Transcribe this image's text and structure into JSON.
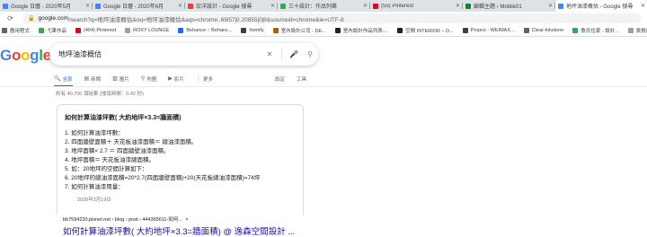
{
  "tabs": [
    {
      "title": "Google 日曆 - 2020年5月",
      "color": "#4285f4",
      "active": false
    },
    {
      "title": "Google 日曆 - 2020年6月",
      "color": "#4285f4",
      "active": false
    },
    {
      "title": "宏洋設計 - Google 搜尋",
      "color": "#ea4335",
      "active": false
    },
    {
      "title": "三十設計：作品列舉",
      "color": "#34a853",
      "active": false
    },
    {
      "title": "(55) Pinterest",
      "color": "#e60023",
      "active": false
    },
    {
      "title": "編輯主題 › Mobile01",
      "color": "#188038",
      "active": false
    },
    {
      "title": "地坪油漆概估 - Google 搜尋",
      "color": "#4285f4",
      "active": true
    }
  ],
  "address_bar": {
    "host": "google.com",
    "path": "/search?q=地坪油漆概估&oq=地坪油漆概估&aqs=chrome..69i57j0.20855j0j8&sourceid=chrome&ie=UTF-8"
  },
  "bookmarks": [
    {
      "label": "應用程式",
      "color": "#5f6368"
    },
    {
      "label": "弋果作品",
      "color": "#34a853"
    },
    {
      "label": "(404) Pinterest",
      "color": "#e60023"
    },
    {
      "label": "ROXY LOUNGE",
      "color": "#9aa0a6"
    },
    {
      "label": "Behance :: Behanc...",
      "color": "#1769ff"
    },
    {
      "label": "homify",
      "color": "#3c4043"
    },
    {
      "label": "室內設計公司 - DE...",
      "color": "#b06000"
    },
    {
      "label": "室內設計作品列表-...",
      "color": "#202124"
    },
    {
      "label": "空間 INTERIOR – D...",
      "color": "#202124"
    },
    {
      "label": "Project - WEIMAX...",
      "color": "#3c4043"
    },
    {
      "label": "Clear-Inkstone",
      "color": "#5f6368"
    },
    {
      "label": "詹氏住家 - 設計...",
      "color": "#34a853"
    },
    {
      "label": "挑殼設計 - G",
      "color": "#9aa0a6"
    }
  ],
  "logo": {
    "letters": [
      {
        "ch": "G",
        "color": "#4285f4"
      },
      {
        "ch": "o",
        "color": "#ea4335"
      },
      {
        "ch": "o",
        "color": "#fbbc05"
      },
      {
        "ch": "g",
        "color": "#4285f4"
      },
      {
        "ch": "l",
        "color": "#34a853"
      },
      {
        "ch": "e",
        "color": "#ea4335"
      }
    ]
  },
  "search": {
    "query": "地坪油漆概估"
  },
  "result_tabs": [
    {
      "label": "全部",
      "icon": "search-icon",
      "glyph": "🔍",
      "active": true
    },
    {
      "label": "新聞",
      "icon": "news-icon",
      "glyph": "▤",
      "active": false
    },
    {
      "label": "圖片",
      "icon": "image-icon",
      "glyph": "▨",
      "active": false
    },
    {
      "label": "地圖",
      "icon": "map-pin-icon",
      "glyph": "⚲",
      "active": false
    },
    {
      "label": "影片",
      "icon": "video-icon",
      "glyph": "▶",
      "active": false
    },
    {
      "label": "更多",
      "icon": "more-icon",
      "glyph": "⋮",
      "active": false
    }
  ],
  "tools": {
    "settings": "設定",
    "tools": "工具"
  },
  "stats": "約有 40,700 項結果 (搜尋時間：0.42 秒)",
  "snippet": {
    "title": "如何計算油漆坪數( 大約地坪×3.3=牆面積)",
    "steps": [
      "1. 如何計算油漆坪數：",
      "2. 四面牆壁面積＋ 天花板油漆面積＝ 總油漆面積。",
      "3. 地坪面積× 2.7 ＝ 四面牆壁油漆面積。",
      "4. 地坪面積＝ 天花板油漆總面積。",
      "5. 如：20地坪的空間計算如下：",
      "6. 20地坪的總油漆面積=20*2.7(四面牆壁面積)+20(天花板總油漆面積)=74坪",
      "7. 如何計算油漆用量："
    ],
    "date": "2020年2月19日"
  },
  "result": {
    "source": "bb7594230.pixnet.net › blog › post › 444365611-如何...",
    "more": "▾",
    "title": "如何計算油漆坪數( 大約地坪×3.3=牆面積) @ 逸森空間設計 ..."
  }
}
